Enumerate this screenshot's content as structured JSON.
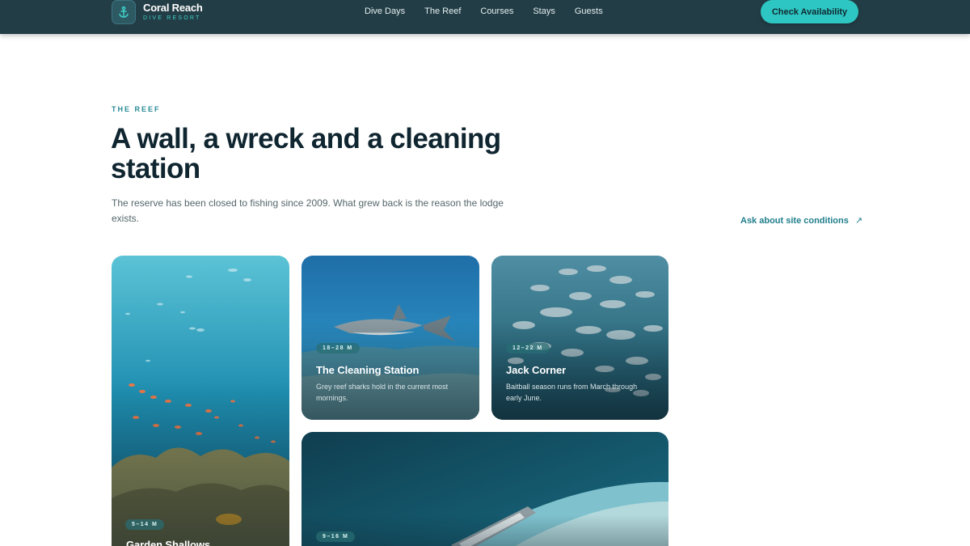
{
  "brand": {
    "name": "Coral Reach",
    "tagline": "DIVE RESORT",
    "icon": "anchor-icon"
  },
  "nav": {
    "links": [
      "Dive Days",
      "The Reef",
      "Courses",
      "Stays",
      "Guests"
    ],
    "cta_label": "Check Availability"
  },
  "hero": {
    "eyebrow": "THE REEF",
    "headline": "A wall, a wreck and a cleaning station",
    "lede": "The reserve has been closed to fishing since 2009. What grew back is the reason the lodge exists.",
    "site_link_label": "Ask about site conditions",
    "site_link_icon": "arrow-up-right-icon"
  },
  "cards": [
    {
      "id": "garden",
      "depth": "5–14 M",
      "title": "Garden Shallows",
      "text": ""
    },
    {
      "id": "cleaning",
      "depth": "18–28 M",
      "title": "The Cleaning Station",
      "text": "Grey reef sharks hold in the current most mornings."
    },
    {
      "id": "jack",
      "depth": "12–22 M",
      "title": "Jack Corner",
      "text": "Baitball season runs from March through early June."
    },
    {
      "id": "wreck",
      "depth": "9–16 M",
      "title": "",
      "text": ""
    }
  ],
  "colors": {
    "nav_bg": "#233d46",
    "accent": "#2ec6c2",
    "eyebrow": "#2a8b96",
    "link": "#207e8c"
  }
}
